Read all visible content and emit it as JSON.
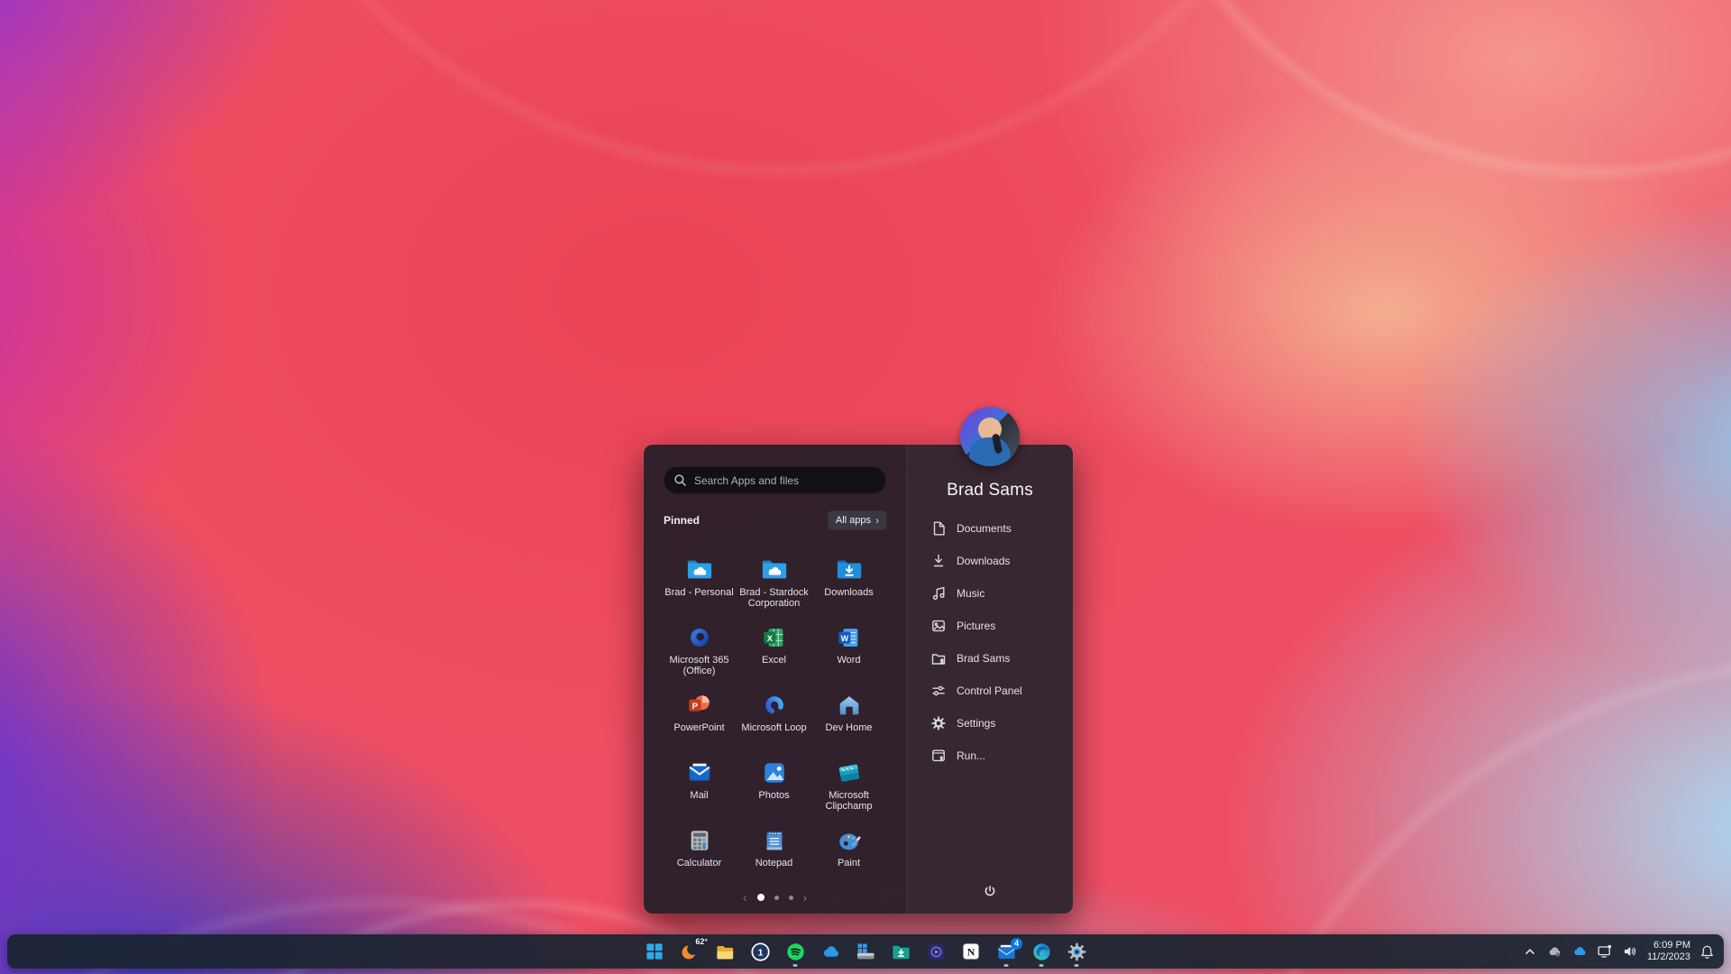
{
  "colors": {
    "accent_blue": "#2f9df0",
    "menu_bg": "#211e28",
    "taskbar_bg": "#19232f",
    "badge_blue": "#0b79e0",
    "spotify_green": "#1ed760",
    "wallpaper_pink": "#ee4e63",
    "wallpaper_purple": "#8d2ed8",
    "wallpaper_blue": "#2136cf",
    "wallpaper_lightblue": "#a8dbf5"
  },
  "glyphs": {
    "excel": "X",
    "word": "W",
    "powerpoint": "P",
    "onepassword": "1",
    "notion": "N",
    "all_apps_chevron": "›",
    "pager_prev": "‹",
    "pager_next": "›"
  },
  "start_menu": {
    "search": {
      "placeholder": "Search Apps and files"
    },
    "pinned_label": "Pinned",
    "all_apps_label": "All apps",
    "apps": [
      {
        "name": "Brad - Personal",
        "icon": "onedrive-folder"
      },
      {
        "name": "Brad - Stardock Corporation",
        "icon": "onedrive-folder"
      },
      {
        "name": "Downloads",
        "icon": "downloads-folder"
      },
      {
        "name": "Microsoft 365 (Office)",
        "icon": "microsoft-365"
      },
      {
        "name": "Excel",
        "icon": "excel"
      },
      {
        "name": "Word",
        "icon": "word"
      },
      {
        "name": "PowerPoint",
        "icon": "powerpoint"
      },
      {
        "name": "Microsoft Loop",
        "icon": "loop"
      },
      {
        "name": "Dev Home",
        "icon": "dev-home"
      },
      {
        "name": "Mail",
        "icon": "mail"
      },
      {
        "name": "Photos",
        "icon": "photos"
      },
      {
        "name": "Microsoft Clipchamp",
        "icon": "clipchamp"
      },
      {
        "name": "Calculator",
        "icon": "calculator"
      },
      {
        "name": "Notepad",
        "icon": "notepad"
      },
      {
        "name": "Paint",
        "icon": "paint"
      }
    ],
    "pagination": {
      "pages": 3,
      "active_page": 1
    },
    "user": {
      "name": "Brad Sams"
    },
    "links": [
      {
        "label": "Documents",
        "icon": "document"
      },
      {
        "label": "Downloads",
        "icon": "download-arrow"
      },
      {
        "label": "Music",
        "icon": "music-note"
      },
      {
        "label": "Pictures",
        "icon": "picture"
      },
      {
        "label": "Brad Sams",
        "icon": "user-folder"
      },
      {
        "label": "Control Panel",
        "icon": "sliders"
      },
      {
        "label": "Settings",
        "icon": "gear"
      },
      {
        "label": "Run...",
        "icon": "run-window"
      }
    ]
  },
  "taskbar": {
    "weather_temp": "62°",
    "mail_badge": "4",
    "icons": [
      {
        "name": "start",
        "running": false
      },
      {
        "name": "weather-moon",
        "running": false
      },
      {
        "name": "file-explorer",
        "running": false
      },
      {
        "name": "1password",
        "running": false
      },
      {
        "name": "spotify",
        "running": true
      },
      {
        "name": "onedrive",
        "running": false
      },
      {
        "name": "storage-drive",
        "running": false
      },
      {
        "name": "downloads-folder",
        "running": false
      },
      {
        "name": "media-app",
        "running": false
      },
      {
        "name": "notion",
        "running": false
      },
      {
        "name": "mail",
        "running": true,
        "badge": "4"
      },
      {
        "name": "edge",
        "running": true
      },
      {
        "name": "settings",
        "running": true
      }
    ],
    "tray": {
      "time": "6:09 PM",
      "date": "11/2/2023",
      "icons": [
        "hidden-icons-chevron",
        "cloud-sync",
        "onedrive",
        "display-connect",
        "volume",
        "notifications-bell"
      ]
    }
  }
}
